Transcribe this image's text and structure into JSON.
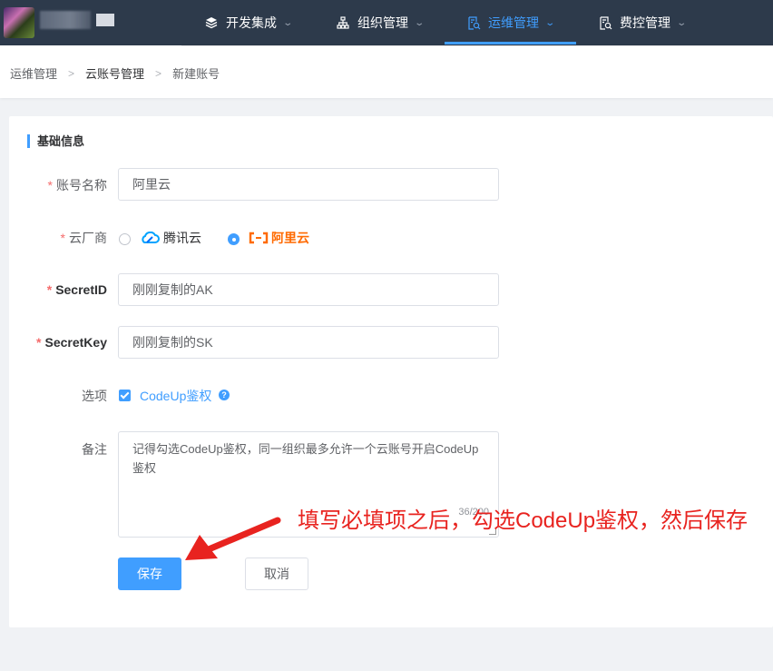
{
  "nav": {
    "items": [
      {
        "label": "开发集成",
        "icon": "cube-stack-icon",
        "active": false
      },
      {
        "label": "组织管理",
        "icon": "org-tree-icon",
        "active": false
      },
      {
        "label": "运维管理",
        "icon": "ops-doc-search-icon",
        "active": true
      },
      {
        "label": "费控管理",
        "icon": "cost-doc-search-icon",
        "active": false
      }
    ],
    "accent": "#409eff",
    "bg": "#2d3a4b"
  },
  "breadcrumb": [
    "运维管理",
    "云账号管理",
    "新建账号"
  ],
  "form": {
    "section_title": "基础信息",
    "account_name": {
      "label": "账号名称",
      "value": "阿里云"
    },
    "provider": {
      "label": "云厂商",
      "options": [
        "腾讯云",
        "阿里云"
      ],
      "selected": "阿里云"
    },
    "secret_id": {
      "label": "SecretID",
      "value": "刚刚复制的AK"
    },
    "secret_key": {
      "label": "SecretKey",
      "value": "刚刚复制的SK"
    },
    "options": {
      "label": "选项",
      "checkbox_label": "CodeUp鉴权",
      "checked": true,
      "help": "?"
    },
    "remark": {
      "label": "备注",
      "value": "记得勾选CodeUp鉴权，同一组织最多允许一个云账号开启CodeUp鉴权",
      "counter": "36/200"
    },
    "save_label": "保存",
    "cancel_label": "取消"
  },
  "annotation": {
    "text": "填写必填项之后，勾选CodeUp鉴权，然后保存",
    "color": "#e8231f"
  }
}
